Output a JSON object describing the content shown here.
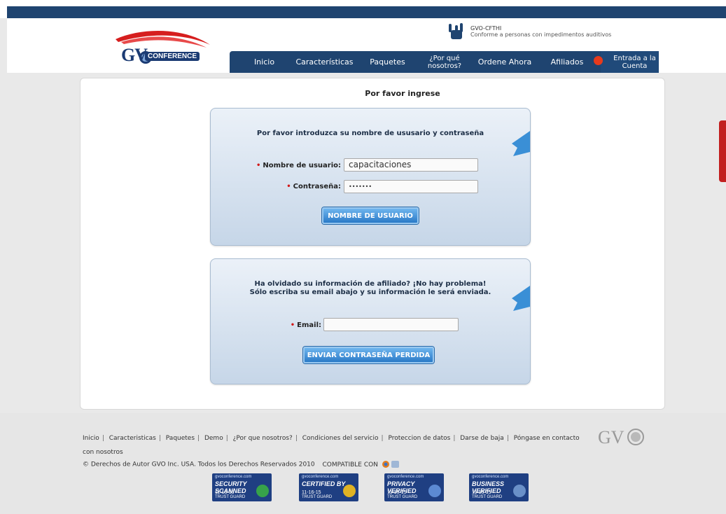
{
  "header": {
    "logo_text": "GV",
    "logo_subtext": "CONFERENCE",
    "accessibility": {
      "title": "GVO-CFTHI",
      "text": "Conforme a personas con impedimentos auditivos"
    }
  },
  "nav": {
    "items": [
      {
        "label": "Inicio"
      },
      {
        "label": "Características"
      },
      {
        "label": "Paquetes"
      },
      {
        "label": "¿Por qué nosotros?"
      },
      {
        "label": "Ordene Ahora"
      },
      {
        "label": "Afiliados"
      },
      {
        "label": "Entrada a la Cuenta"
      }
    ]
  },
  "main": {
    "heading": "Por favor ingrese",
    "login": {
      "heading": "Por favor introduzca su nombre de ususario y contraseña",
      "username_label": "Nombre de usuario:",
      "username_value": "capacitaciones",
      "password_label": "Contraseña:",
      "password_value": "•••••••",
      "submit_label": "NOMBRE DE USUARIO"
    },
    "recover": {
      "heading_line1": "Ha olvidado su información de afiliado? ¡No hay problema!",
      "heading_line2": "Sólo escriba su email abajo y su información le será enviada.",
      "email_label": "Email:",
      "email_value": "",
      "submit_label": "ENVIAR CONTRASEÑA PERDIDA"
    }
  },
  "footer": {
    "links": [
      "Inicio",
      "Caracteristicas",
      "Paquetes",
      "Demo",
      "¿Por que nosotros?",
      "Condiciones del servicio",
      "Proteccion de datos",
      "Darse de baja",
      "Póngase en contacto con nosotros"
    ],
    "copyright": "© Derechos de Autor GVO Inc. USA. Todos los Derechos Reservados 2010",
    "compatible": "COMPATIBLE CON",
    "gvo_logo": "GV",
    "badges": [
      {
        "site": "gvoconference.com",
        "title": "SECURITY SCANNED",
        "date": "11-16-15",
        "tag": "TRUST GUARD",
        "color": "#37a24a"
      },
      {
        "site": "gvoconference.com",
        "title": "CERTIFIED BY",
        "date": "11-16-15",
        "tag": "TRUST GUARD",
        "color": "#e0b324"
      },
      {
        "site": "gvoconference.com",
        "title": "PRIVACY VERIFIED",
        "date": "11-16-15",
        "tag": "TRUST GUARD",
        "color": "#5c8ad3"
      },
      {
        "site": "gvoconference.com",
        "title": "BUSINESS VERIFIED",
        "date": "11-16-15",
        "tag": "TRUST GUARD",
        "color": "#6a90c8"
      }
    ]
  }
}
